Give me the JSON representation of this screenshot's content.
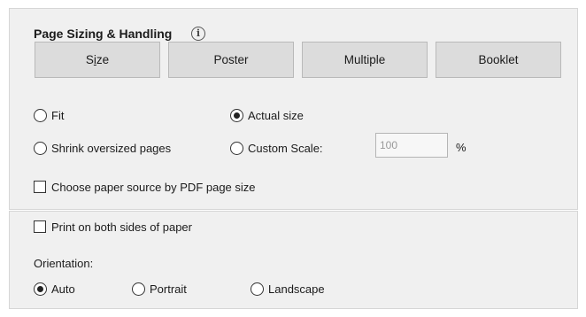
{
  "section": {
    "title": "Page Sizing & Handling",
    "info_glyph": "i"
  },
  "tabs": [
    {
      "label_pre": "S",
      "label_mnemonic": "i",
      "label_post": "ze"
    },
    {
      "label": "Poster"
    },
    {
      "label": "Multiple"
    },
    {
      "label": "Booklet"
    }
  ],
  "options": {
    "fit": "Fit",
    "actual_size": "Actual size",
    "shrink": "Shrink oversized pages",
    "custom_scale": "Custom Scale:",
    "custom_scale_value": "100",
    "percent": "%",
    "paper_source": "Choose paper source by PDF page size",
    "selected": "actual_size"
  },
  "duplex": {
    "label": "Print on both sides of paper",
    "checked": false
  },
  "orientation": {
    "label": "Orientation:",
    "auto": "Auto",
    "portrait": "Portrait",
    "landscape": "Landscape",
    "selected": "auto"
  }
}
